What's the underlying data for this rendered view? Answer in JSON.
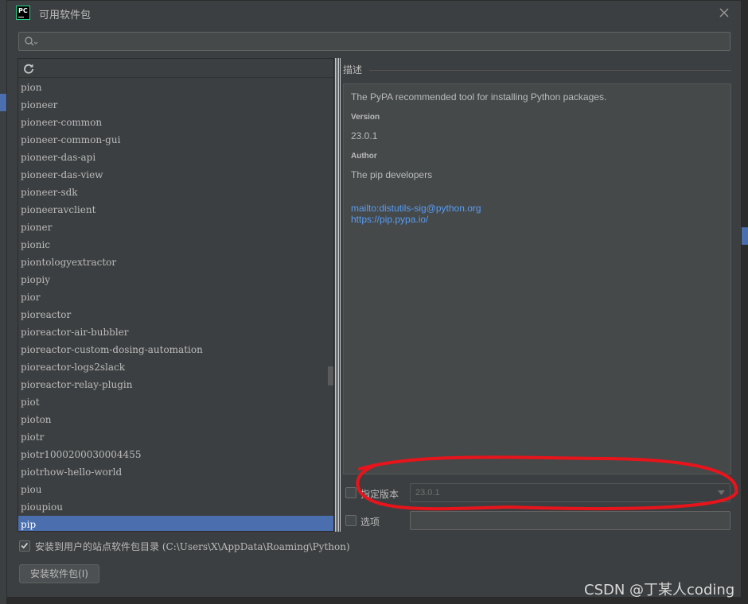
{
  "window": {
    "app_icon_text": "PC",
    "title": "可用软件包"
  },
  "search": {
    "placeholder": "",
    "value": ""
  },
  "packages": {
    "items": [
      "pion",
      "pioneer",
      "pioneer-common",
      "pioneer-common-gui",
      "pioneer-das-api",
      "pioneer-das-view",
      "pioneer-sdk",
      "pioneeravclient",
      "pioner",
      "pionic",
      "piontologyextractor",
      "piopiy",
      "pior",
      "pioreactor",
      "pioreactor-air-bubbler",
      "pioreactor-custom-dosing-automation",
      "pioreactor-logs2slack",
      "pioreactor-relay-plugin",
      "piot",
      "pioton",
      "piotr",
      "piotr1000200030004455",
      "piotrhow-hello-world",
      "piou",
      "pioupiou",
      "pip"
    ],
    "selected_index": 25
  },
  "description": {
    "header": "描述",
    "summary": "The PyPA recommended tool for installing Python packages.",
    "version_label": "Version",
    "version_value": "23.0.1",
    "author_label": "Author",
    "author_value": "The pip developers",
    "links": [
      "mailto:distutils-sig@python.org",
      "https://pip.pypa.io/"
    ]
  },
  "specify_version": {
    "label": "指定版本",
    "checked": false,
    "value": "23.0.1"
  },
  "options": {
    "label": "选项",
    "checked": false,
    "value": ""
  },
  "install_to_user": {
    "checked": true,
    "label": "安装到用户的站点软件包目录",
    "path": "(C:\\Users\\X\\AppData\\Roaming\\Python)"
  },
  "install_button": {
    "label": "安装软件包(I)"
  },
  "watermark": {
    "text": "CSDN @丁某人coding"
  },
  "colors": {
    "selection": "#4b6eaf",
    "link": "#589df6",
    "annotation": "#e8141b"
  }
}
